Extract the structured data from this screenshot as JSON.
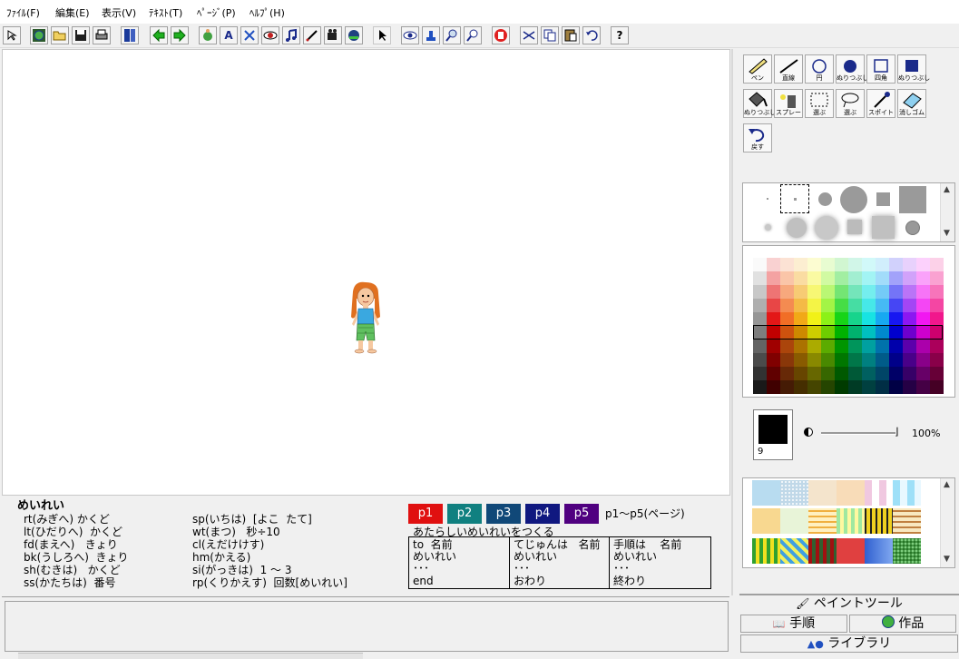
{
  "menu": [
    "ﾌｧｲﾙ(F)",
    "編集(E)",
    "表示(V)",
    "ﾃｷｽﾄ(T)",
    "ﾍﾟｰｼﾞ(P)",
    "ﾍﾙﾌﾟ(H)"
  ],
  "toolbar": {
    "icons": [
      "cursor-icon",
      "globe-icon",
      "open-folder-icon",
      "save-icon",
      "print-icon",
      "book-icon",
      "back-arrow-icon",
      "forward-arrow-icon",
      "turtle-icon",
      "text-a-icon",
      "tools-icon",
      "eye-record-icon",
      "music-icon",
      "pen-icon",
      "film-icon",
      "helmet-icon",
      "pointer-icon",
      "eye-icon",
      "stamp-icon",
      "zoom-in-icon",
      "zoom-out-icon",
      "stop-hand-icon",
      "scissors-icon",
      "copy-icon",
      "paste-icon",
      "undo-icon",
      "help-icon"
    ],
    "help_label": "?",
    "text_a_label": "A"
  },
  "commands": {
    "header": "めいれい",
    "left": [
      "rt(みぎへ) かくど",
      "lt(ひだりへ)  かくど",
      "fd(まえへ)   きょり",
      "bk(うしろへ)  きょり",
      "sh(むきは)   かくど",
      "ss(かたちは)  番号"
    ],
    "right": [
      "sp(いちは)  [よこ  たて]",
      "wt(まつ)   秒÷10",
      "cl(えだけけす)",
      "hm(かえる)",
      "si(がっきは)  1 ～ 3",
      "rp(くりかえす)  回数[めいれい]"
    ]
  },
  "pages": {
    "buttons": [
      {
        "label": "p1",
        "color": "#e01010"
      },
      {
        "label": "p2",
        "color": "#108080"
      },
      {
        "label": "p3",
        "color": "#104878"
      },
      {
        "label": "p4",
        "color": "#101880"
      },
      {
        "label": "p5",
        "color": "#500080"
      }
    ],
    "range_label": "p1～p5(ページ)",
    "new_command_label": "あたらしいめいれいをつくる"
  },
  "templates": [
    {
      "lines": [
        "to  名前",
        "めいれい",
        "･･･",
        "end"
      ]
    },
    {
      "lines": [
        "てじゅんは   名前",
        "めいれい",
        "･･･",
        "おわり"
      ]
    },
    {
      "lines": [
        "手順は    名前",
        "めいれい",
        "･･･",
        "終わり"
      ]
    }
  ],
  "paint_tools": [
    {
      "name": "pen-tool",
      "label": "ペン"
    },
    {
      "name": "line-tool",
      "label": "直線"
    },
    {
      "name": "circle-tool",
      "label": "円"
    },
    {
      "name": "filled-circle-tool",
      "label": "ぬりつぶし"
    },
    {
      "name": "rectangle-tool",
      "label": "四角"
    },
    {
      "name": "filled-rectangle-tool",
      "label": "ぬりつぶし"
    },
    {
      "name": "fill-tool",
      "label": "ぬりつぶし"
    },
    {
      "name": "spray-tool",
      "label": "スプレー"
    },
    {
      "name": "rect-select-tool",
      "label": "選ぶ"
    },
    {
      "name": "lasso-select-tool",
      "label": "選ぶ"
    },
    {
      "name": "dropper-tool",
      "label": "スポイト"
    },
    {
      "name": "eraser-tool",
      "label": "消しゴム"
    },
    {
      "name": "undo-tool",
      "label": "戻す"
    }
  ],
  "current_color": {
    "hex": "#000000",
    "size": "9"
  },
  "opacity": {
    "value_label": "100%",
    "value": 1.0
  },
  "tabs": {
    "paint": "ペイントツール",
    "procedure": "手順",
    "works": "作品",
    "library": "ライブラリ"
  },
  "colors": {
    "palette_columns": [
      "#808080",
      "#e00000",
      "#f06010",
      "#f0a000",
      "#f0f000",
      "#80f000",
      "#00d000",
      "#00d080",
      "#00e0e0",
      "#00a0f0",
      "#0000f0",
      "#8000f0",
      "#f000f0",
      "#f00080"
    ]
  }
}
